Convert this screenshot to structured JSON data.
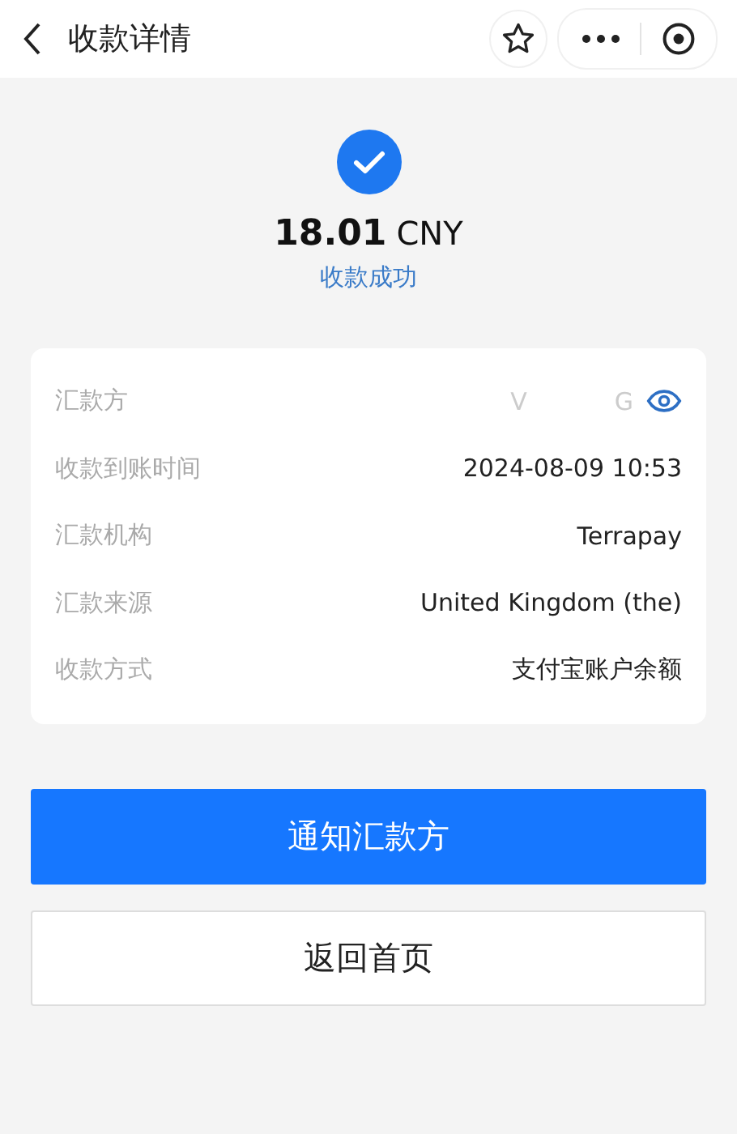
{
  "header": {
    "title": "收款详情"
  },
  "result": {
    "amount": "18.01",
    "currency": "CNY",
    "status": "收款成功"
  },
  "details": [
    {
      "label": "汇款方",
      "kind": "masked",
      "visible_parts": [
        "V",
        "G"
      ]
    },
    {
      "label": "收款到账时间",
      "kind": "text",
      "value": "2024-08-09 10:53"
    },
    {
      "label": "汇款机构",
      "kind": "text",
      "value": "Terrapay"
    },
    {
      "label": "汇款来源",
      "kind": "text",
      "value": "United Kingdom (the)"
    },
    {
      "label": "收款方式",
      "kind": "text",
      "value": "支付宝账户余额"
    }
  ],
  "buttons": [
    {
      "label": "通知汇款方",
      "kind": "primary"
    },
    {
      "label": "返回首页",
      "kind": "secondary"
    }
  ]
}
